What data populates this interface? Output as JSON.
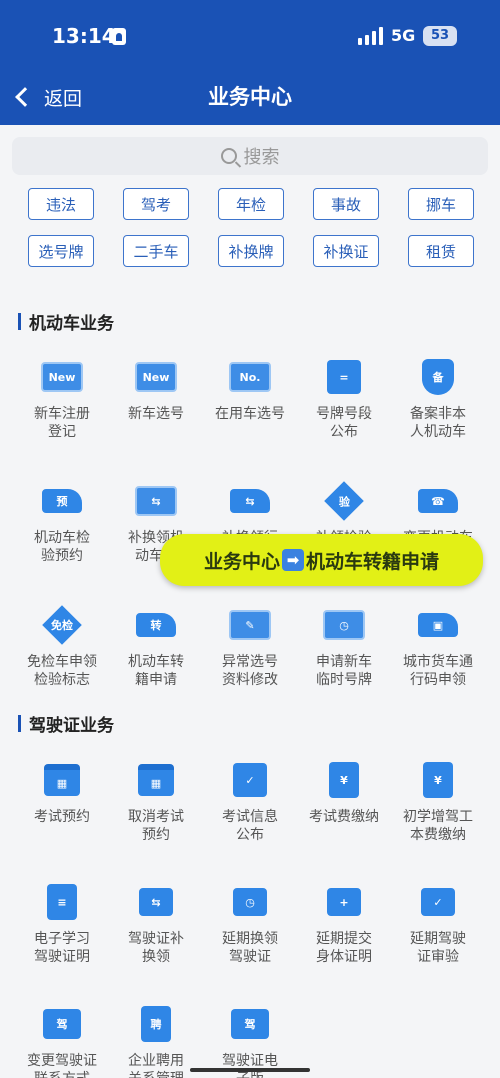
{
  "status": {
    "time": "13:14",
    "network": "5G",
    "battery": "53"
  },
  "nav": {
    "back_label": "返回",
    "title": "业务中心"
  },
  "search": {
    "placeholder": "搜索"
  },
  "tags": [
    "违法",
    "驾考",
    "年检",
    "事故",
    "挪车",
    "选号牌",
    "二手车",
    "补换牌",
    "补换证",
    "租赁"
  ],
  "sections": {
    "vehicle": {
      "title": "机动车业务",
      "items": [
        {
          "label": "新车注册\n登记",
          "icon": "new-card-icon",
          "glyph": "New"
        },
        {
          "label": "新车选号",
          "icon": "new-plate-icon",
          "glyph": "New"
        },
        {
          "label": "在用车选号",
          "icon": "number-plate-icon",
          "glyph": "No."
        },
        {
          "label": "号牌号段\n公布",
          "icon": "plate-sign-icon",
          "glyph": "="
        },
        {
          "label": "备案非本\n人机动车",
          "icon": "record-shield-icon",
          "glyph": "备"
        },
        {
          "label": "机动车检\n验预约",
          "icon": "truck-appointment-icon",
          "glyph": "预"
        },
        {
          "label": "补换领机\n动车号",
          "icon": "swap-card-icon",
          "glyph": "⇆"
        },
        {
          "label": "补换领行",
          "icon": "truck-swap-icon",
          "glyph": "⇆"
        },
        {
          "label": "补领检验",
          "icon": "inspection-diamond-icon",
          "glyph": "验"
        },
        {
          "label": "变更机动车",
          "icon": "truck-phone-icon",
          "glyph": "☎"
        },
        {
          "label": "免检车申领\n检验标志",
          "icon": "exempt-diamond-icon",
          "glyph": "免检"
        },
        {
          "label": "机动车转\n籍申请",
          "icon": "truck-transfer-icon",
          "glyph": "转"
        },
        {
          "label": "异常选号\n资料修改",
          "icon": "edit-card-icon",
          "glyph": "✎"
        },
        {
          "label": "申请新车\n临时号牌",
          "icon": "temp-plate-icon",
          "glyph": "◷"
        },
        {
          "label": "城市货车通\n行码申领",
          "icon": "cargo-truck-icon",
          "glyph": "▣"
        }
      ]
    },
    "license": {
      "title": "驾驶证业务",
      "items": [
        {
          "label": "考试预约",
          "icon": "calendar-icon",
          "glyph": "▦"
        },
        {
          "label": "取消考试\n预约",
          "icon": "calendar-cancel-icon",
          "glyph": "▦"
        },
        {
          "label": "考试信息\n公布",
          "icon": "notice-icon",
          "glyph": "✓"
        },
        {
          "label": "考试费缴纳",
          "icon": "fee-receipt-icon",
          "glyph": "¥"
        },
        {
          "label": "初学增驾工\n本费缴纳",
          "icon": "fee-list-icon",
          "glyph": "¥"
        },
        {
          "label": "电子学习\n驾驶证明",
          "icon": "study-doc-icon",
          "glyph": "≡"
        },
        {
          "label": "驾驶证补\n换领",
          "icon": "license-swap-icon",
          "glyph": "⇆"
        },
        {
          "label": "延期换领\n驾驶证",
          "icon": "license-delay-icon",
          "glyph": "◷"
        },
        {
          "label": "延期提交\n身体证明",
          "icon": "health-delay-icon",
          "glyph": "+"
        },
        {
          "label": "延期驾驶\n证审验",
          "icon": "license-check-icon",
          "glyph": "✓"
        },
        {
          "label": "变更驾驶证\n联系方式",
          "icon": "license-phone-icon",
          "glyph": "驾"
        },
        {
          "label": "企业聘用\n关系管理",
          "icon": "employ-doc-icon",
          "glyph": "聘"
        },
        {
          "label": "驾驶证电\n子版",
          "icon": "e-license-icon",
          "glyph": "驾"
        }
      ]
    }
  },
  "banner": {
    "left": "业务中心",
    "arrow": "➡",
    "right": "机动车转籍申请"
  },
  "colors": {
    "header": "#1a52b5",
    "accent": "#2f86e6",
    "banner": "#e2f016"
  }
}
